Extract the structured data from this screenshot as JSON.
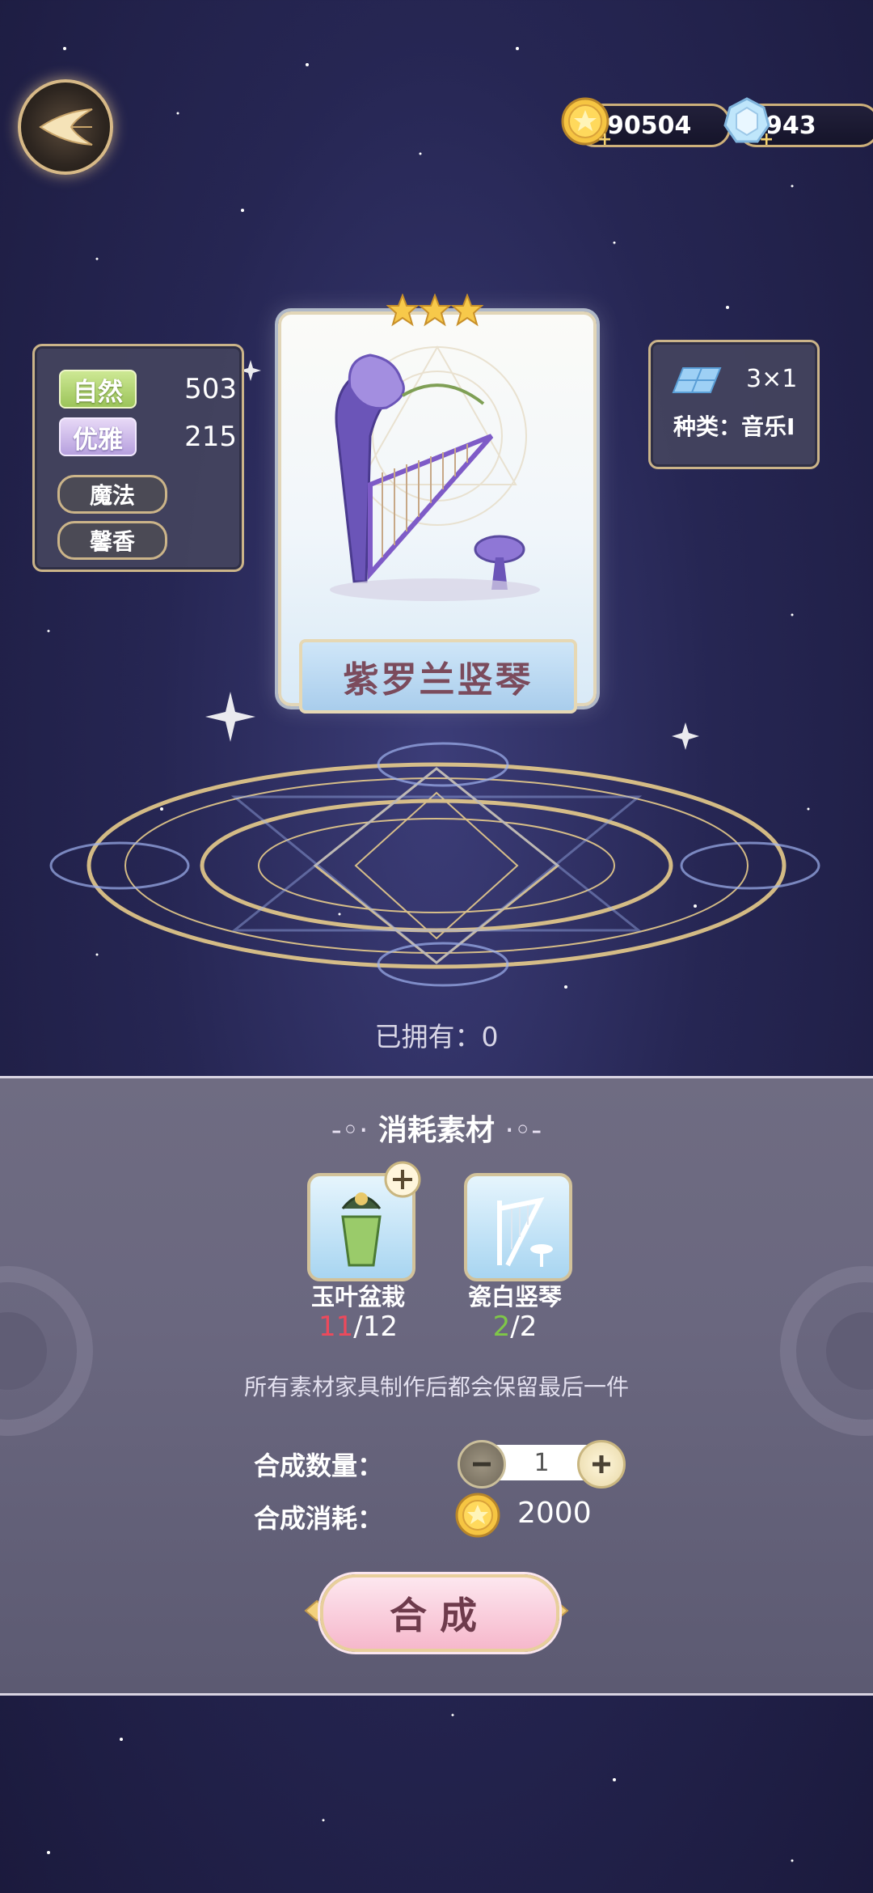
{
  "top_bar": {
    "gold_amount": "90504",
    "gem_amount": "943"
  },
  "attributes": {
    "nature_label": "自然",
    "nature_value": "503",
    "elegant_label": "优雅",
    "elegant_value": "215",
    "tags": [
      "魔法",
      "馨香"
    ]
  },
  "size_info": {
    "size": "3×1",
    "category": "种类：音乐I"
  },
  "item": {
    "name": "紫罗兰竖琴",
    "stars": 3
  },
  "owned_text": "已拥有：0",
  "materials": {
    "title": "消耗素材",
    "items": [
      {
        "name": "玉叶盆栽",
        "have": "11",
        "need": "/12"
      },
      {
        "name": "瓷白竖琴",
        "have": "2",
        "need": "/2"
      }
    ],
    "note": "所有素材家具制作后都会保留最后一件"
  },
  "synthesis": {
    "quantity_label": "合成数量：",
    "quantity": "1",
    "cost_label": "合成消耗：",
    "cost": "2000",
    "button_label": "合成"
  },
  "colors": {
    "accent_gold": "#cbb489",
    "have_insufficient": "#ec4a5c",
    "have_enough": "#7fc748"
  }
}
